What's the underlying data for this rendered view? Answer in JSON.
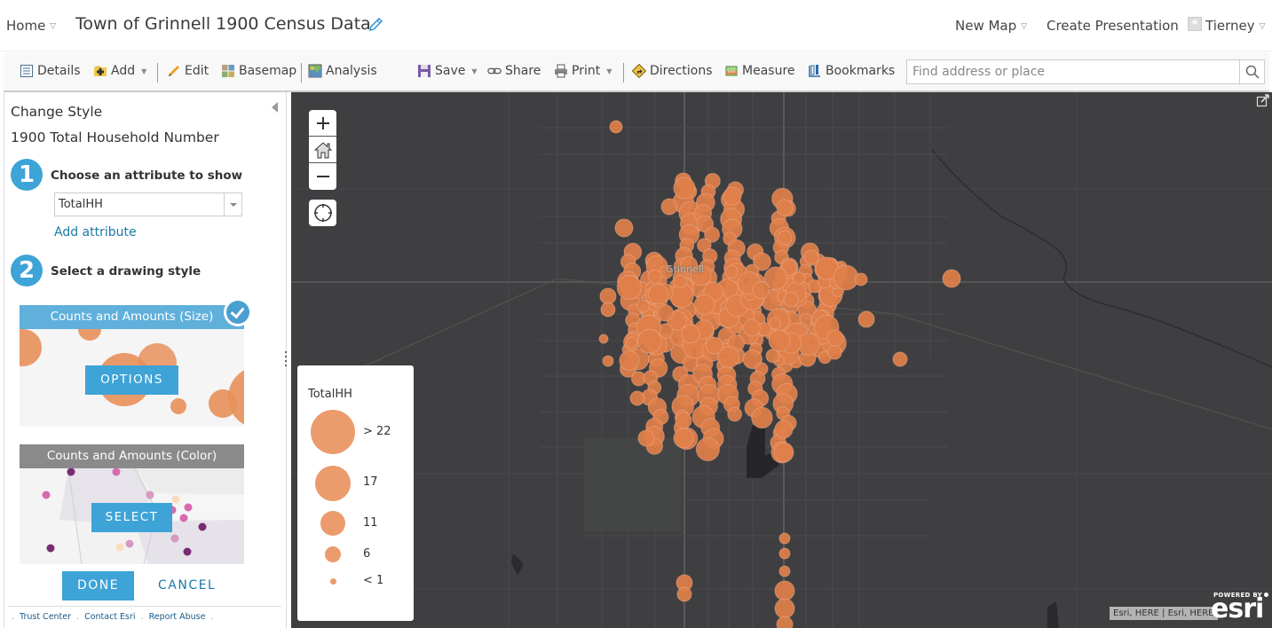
{
  "header": {
    "home_label": "Home",
    "map_title": "Town of Grinnell 1900 Census Data",
    "new_map_label": "New Map",
    "create_presentation_label": "Create Presentation",
    "user_name": "Tierney"
  },
  "toolbar": {
    "details": "Details",
    "add": "Add",
    "edit": "Edit",
    "basemap": "Basemap",
    "analysis": "Analysis",
    "save": "Save",
    "share": "Share",
    "print": "Print",
    "directions": "Directions",
    "measure": "Measure",
    "bookmarks": "Bookmarks",
    "search_placeholder": "Find address or place",
    "search_value": ""
  },
  "panel": {
    "title": "Change Style",
    "layer_name": "1900 Total Household Number",
    "step1": {
      "number": "1",
      "label": "Choose an attribute to show",
      "attribute": "TotalHH",
      "add_attribute": "Add attribute"
    },
    "step2": {
      "number": "2",
      "label": "Select a drawing style"
    },
    "styles": [
      {
        "title": "Counts and Amounts (Size)",
        "button": "OPTIONS",
        "selected": true,
        "header_color": "#5fb0db"
      },
      {
        "title": "Counts and Amounts (Color)",
        "button": "SELECT",
        "selected": false,
        "header_color": "#8a8a8a"
      }
    ],
    "done_label": "DONE",
    "cancel_label": "CANCEL",
    "footer_links": [
      "Trust Center",
      "Contact Esri",
      "Report Abuse"
    ]
  },
  "map": {
    "town_label": "Grinnell",
    "symbol_color": "#e07f4a",
    "background_color": "#3f3f41",
    "legend": {
      "title": "TotalHH",
      "items": [
        {
          "label": "> 22"
        },
        {
          "label": "17"
        },
        {
          "label": "11"
        },
        {
          "label": "6"
        },
        {
          "label": "< 1"
        }
      ]
    },
    "attribution": "Esri, HERE | Esri, HERE",
    "powered_by": "POWERED BY",
    "esri_logo": "esri"
  }
}
